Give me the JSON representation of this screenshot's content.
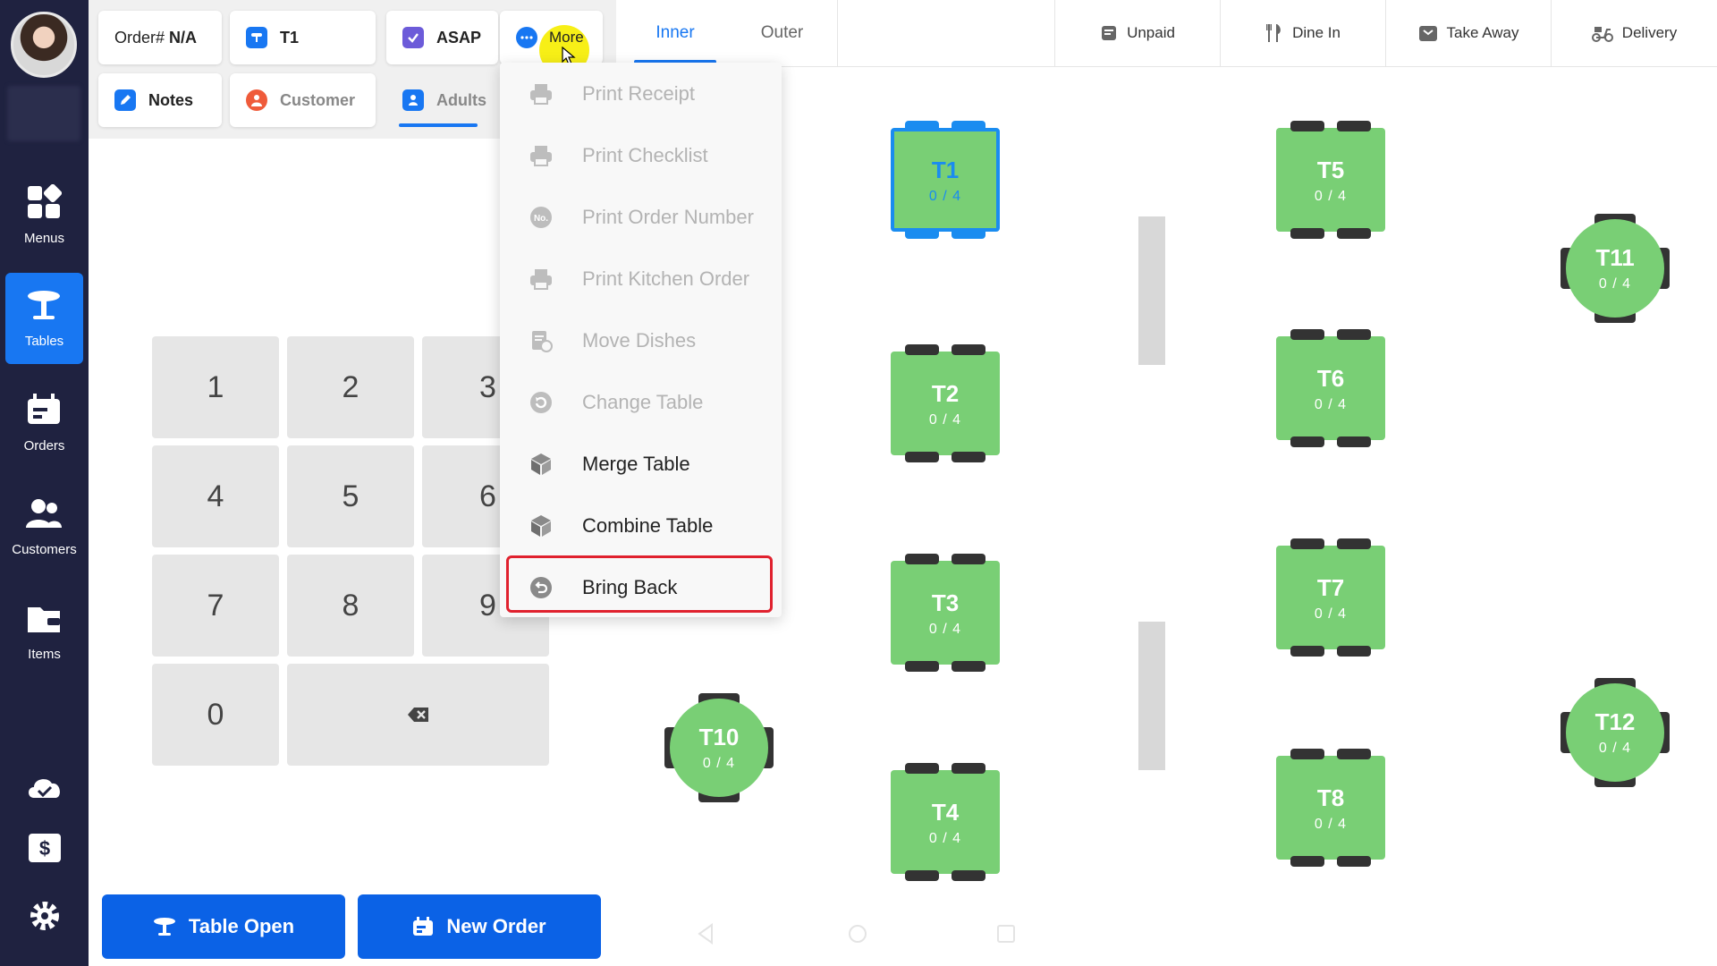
{
  "sidebar": {
    "items": [
      {
        "label": "Menus",
        "icon": "grid-icon"
      },
      {
        "label": "Tables",
        "icon": "table-icon",
        "active": true
      },
      {
        "label": "Orders",
        "icon": "orders-icon"
      },
      {
        "label": "Customers",
        "icon": "customers-icon"
      },
      {
        "label": "Items",
        "icon": "wallet-icon"
      }
    ]
  },
  "order_bar": {
    "order_label": "Order#",
    "order_value": "N/A",
    "table": "T1",
    "time": "ASAP",
    "more": "More",
    "notes": "Notes",
    "customer": "Customer",
    "adults": "Adults"
  },
  "keypad": {
    "keys": [
      "1",
      "2",
      "3",
      "4",
      "5",
      "6",
      "7",
      "8",
      "9",
      "0"
    ]
  },
  "actions": {
    "table_open": "Table Open",
    "new_order": "New Order"
  },
  "area_tabs": [
    {
      "label": "Inner",
      "active": true
    },
    {
      "label": "Outer",
      "active": false
    }
  ],
  "filters": [
    {
      "label": "Unpaid",
      "icon": "receipt-icon"
    },
    {
      "label": "Dine In",
      "icon": "fork-knife-icon"
    },
    {
      "label": "Take Away",
      "icon": "bag-icon"
    },
    {
      "label": "Delivery",
      "icon": "scooter-icon"
    }
  ],
  "tables": [
    {
      "name": "T1",
      "cap": "0 / 4"
    },
    {
      "name": "T2",
      "cap": "0 / 4"
    },
    {
      "name": "T3",
      "cap": "0 / 4"
    },
    {
      "name": "T4",
      "cap": "0 / 4"
    },
    {
      "name": "T5",
      "cap": "0 / 4"
    },
    {
      "name": "T6",
      "cap": "0 / 4"
    },
    {
      "name": "T7",
      "cap": "0 / 4"
    },
    {
      "name": "T8",
      "cap": "0 / 4"
    },
    {
      "name": "T10",
      "cap": "0 / 4"
    },
    {
      "name": "T11",
      "cap": "0 / 4"
    },
    {
      "name": "T12",
      "cap": "0 / 4"
    }
  ],
  "more_menu": {
    "items": [
      {
        "label": "Print Receipt",
        "enabled": false
      },
      {
        "label": "Print Checklist",
        "enabled": false
      },
      {
        "label": "Print Order Number",
        "enabled": false
      },
      {
        "label": "Print Kitchen Order",
        "enabled": false
      },
      {
        "label": "Move Dishes",
        "enabled": false
      },
      {
        "label": "Change Table",
        "enabled": false
      },
      {
        "label": "Merge Table",
        "enabled": true
      },
      {
        "label": "Combine Table",
        "enabled": true
      },
      {
        "label": "Bring Back",
        "enabled": true
      }
    ]
  },
  "colors": {
    "sidebar": "#1f2240",
    "primary": "#1877f2",
    "table_green": "#79cf75",
    "highlight": "#e0212e"
  }
}
